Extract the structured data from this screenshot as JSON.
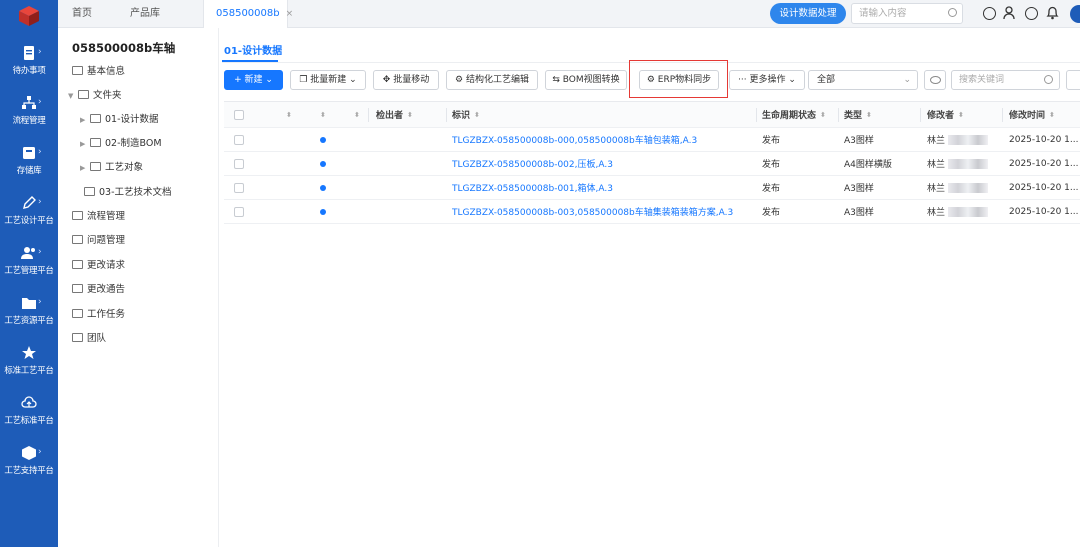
{
  "rail": {
    "items": [
      {
        "label": "待办事项",
        "icon": "document-icon"
      },
      {
        "label": "流程管理",
        "icon": "flow-icon"
      },
      {
        "label": "存储库",
        "icon": "storage-icon"
      },
      {
        "label": "工艺设计平台",
        "icon": "pen-icon"
      },
      {
        "label": "工艺管理平台",
        "icon": "users-icon"
      },
      {
        "label": "工艺资源平台",
        "icon": "folder-icon"
      },
      {
        "label": "标准工艺平台",
        "icon": "star-icon"
      },
      {
        "label": "工艺标准平台",
        "icon": "cloud-icon"
      },
      {
        "label": "工艺支持平台",
        "icon": "cube-icon"
      }
    ]
  },
  "topbar": {
    "tabs": [
      {
        "label": "首页"
      },
      {
        "label": "产品库"
      },
      {
        "label": "058500008b",
        "close": "×"
      }
    ],
    "design_button": "设计数据处理",
    "search_placeholder": "请输入内容"
  },
  "tree": {
    "title": "058500008b车轴",
    "nodes": [
      {
        "label": "基本信息"
      },
      {
        "label": "文件夹"
      },
      {
        "label": "01-设计数据"
      },
      {
        "label": "02-制造BOM"
      },
      {
        "label": "工艺对象"
      },
      {
        "label": "03-工艺技术文档"
      },
      {
        "label": "流程管理"
      },
      {
        "label": "问题管理"
      },
      {
        "label": "更改请求"
      },
      {
        "label": "更改通告"
      },
      {
        "label": "工作任务"
      },
      {
        "label": "团队"
      }
    ]
  },
  "main": {
    "subtab": "01-设计数据",
    "toolbar": {
      "new": "+ 新建",
      "batch_new": "批量新建",
      "batch_move": "批量移动",
      "struct_edit": "结构化工艺编辑",
      "bom_convert": "BOM视图转换",
      "erp_sync": "ERP物料同步",
      "more": "··· 更多操作",
      "filter_value": "全部",
      "keyword_placeholder": "搜索关键词"
    },
    "table": {
      "headers": [
        "检出者",
        "标识",
        "生命周期状态",
        "类型",
        "修改者",
        "修改时间"
      ],
      "rows": [
        {
          "id": "TLGZBZX-058500008b-000,058500008b车轴包装箱,A.3",
          "state": "发布",
          "type": "A3图样",
          "modifier": "林兰",
          "time": "2025-10-20 1..."
        },
        {
          "id": "TLGZBZX-058500008b-002,压板,A.3",
          "state": "发布",
          "type": "A4图样横版",
          "modifier": "林兰",
          "time": "2025-10-20 1..."
        },
        {
          "id": "TLGZBZX-058500008b-001,箱体,A.3",
          "state": "发布",
          "type": "A3图样",
          "modifier": "林兰",
          "time": "2025-10-20 1..."
        },
        {
          "id": "TLGZBZX-058500008b-003,058500008b车轴集装箱装箱方案,A.3",
          "state": "发布",
          "type": "A3图样",
          "modifier": "林兰",
          "time": "2025-10-20 1..."
        }
      ]
    }
  },
  "colors": {
    "rail": "#1e5cb8",
    "accent": "#1677ff",
    "highlight": "#e53935"
  }
}
